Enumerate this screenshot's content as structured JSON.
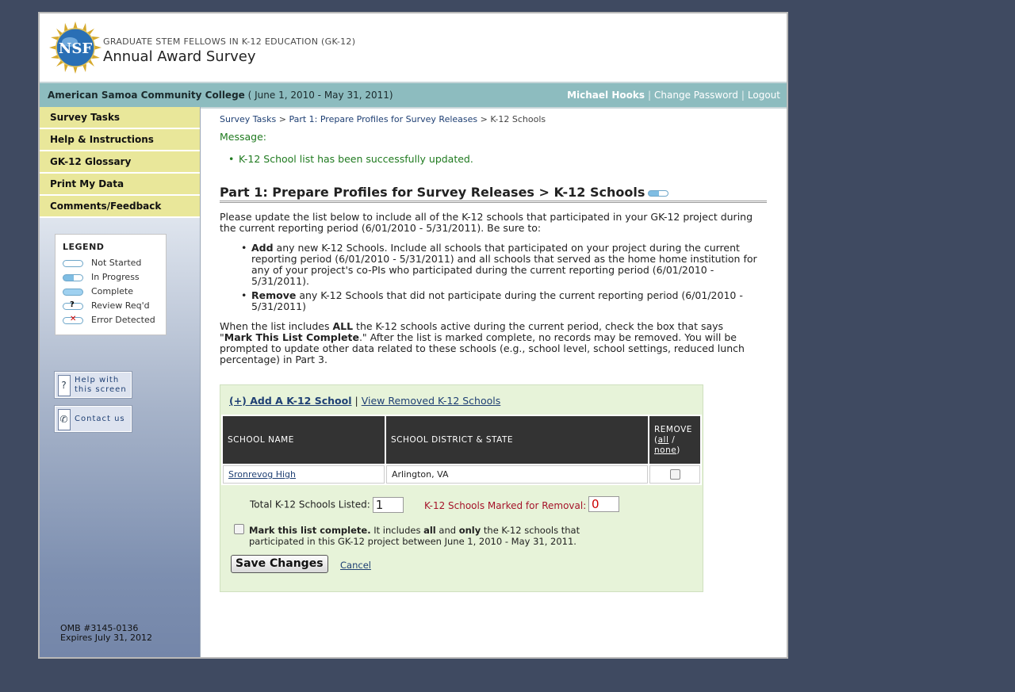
{
  "header": {
    "program": "GRADUATE STEM FELLOWS IN K-12 EDUCATION (GK-12)",
    "title": "Annual Award Survey",
    "logo_text": "NSF"
  },
  "topbar": {
    "institution": "American Samoa Community College",
    "period": "( June 1, 2010 - May 31, 2011)",
    "user": "Michael Hooks",
    "change_password": "Change Password",
    "logout": "Logout",
    "sep": "|"
  },
  "sidebar": {
    "items": [
      {
        "label": "Survey Tasks"
      },
      {
        "label": "Help & Instructions"
      },
      {
        "label": "GK-12 Glossary"
      },
      {
        "label": "Print My Data"
      },
      {
        "label": "Comments/Feedback"
      }
    ],
    "legend": {
      "title": "LEGEND",
      "rows": [
        "Not Started",
        "In Progress",
        "Complete",
        "Review Req'd",
        "Error Detected"
      ]
    },
    "help_line1": "Help with",
    "help_line2": "this screen",
    "contact": "Contact us",
    "omb_line1": "OMB #3145-0136",
    "omb_line2": "Expires July 31, 2012"
  },
  "breadcrumb": {
    "c1": "Survey Tasks",
    "c2": "Part 1: Prepare Profiles for Survey Releases",
    "c3": "K-12 Schools",
    "sep": ">"
  },
  "message": {
    "label": "Message:",
    "text": "K-12 School list has been successfully updated."
  },
  "page_title": "Part 1: Prepare Profiles for Survey Releases > K-12 Schools",
  "intro": "Please update the list below to include all of the K-12 schools that participated in your GK-12 project during the current reporting period (6/01/2010 - 5/31/2011). Be sure to:",
  "bullets": {
    "add_bold": "Add",
    "add_text": " any new K-12 Schools. Include all schools that participated on your project during the current reporting period (6/01/2010 - 5/31/2011) and all schools that served as the home home institution for any of your project's co-PIs who participated during the current reporting period (6/01/2010 - 5/31/2011).",
    "remove_bold": "Remove",
    "remove_text": " any K-12 Schools that did not participate during the current reporting period (6/01/2010 - 5/31/2011)"
  },
  "para2": {
    "t1": "When the list includes ",
    "b1": "ALL",
    "t2": " the K-12 schools active during the current period, check the box that says \"",
    "b2": "Mark This List Complete",
    "t3": ".\" After the list is marked complete, no records may be removed. You will be prompted to update other data related to these schools (e.g., school level, school settings, reduced lunch percentage) in Part 3."
  },
  "panel": {
    "add_link": "(+) Add A K-12 School",
    "view_removed": "View Removed K-12 Schools",
    "sep": "|",
    "col_school": "SCHOOL NAME",
    "col_district": "SCHOOL DISTRICT & STATE",
    "col_remove": "REMOVE",
    "all": "all",
    "none": "none",
    "rows": [
      {
        "school": "Sronrevog High",
        "district": "Arlington, VA"
      }
    ],
    "total_label": "Total K-12 Schools Listed:",
    "total_value": "1",
    "removal_label": "K-12 Schools Marked for Removal:",
    "removal_value": "0",
    "complete_bold": "Mark this list complete.",
    "complete_t1": " It includes ",
    "complete_b2": "all",
    "complete_t2": " and ",
    "complete_b3": "only",
    "complete_t3": " the K-12 schools that participated in this GK-12 project between June 1, 2010 - May 31, 2011.",
    "save": "Save Changes",
    "cancel": "Cancel"
  }
}
